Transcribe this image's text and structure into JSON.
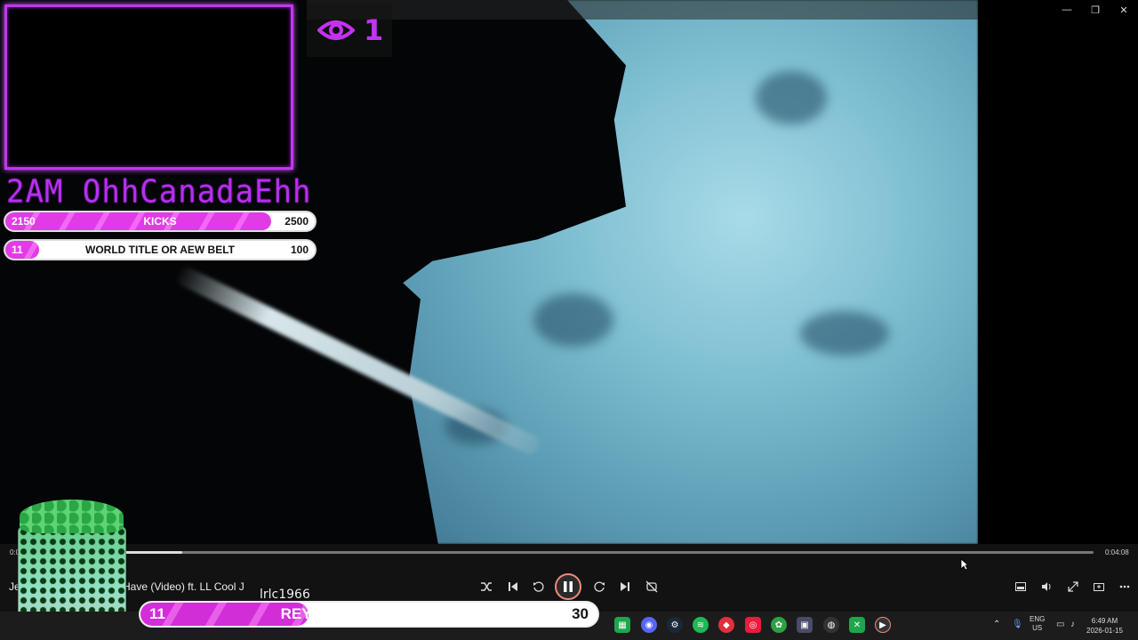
{
  "window": {
    "minimize_icon": "minimize-icon",
    "maximize_icon": "maximize-icon",
    "close_icon": "close-icon",
    "minimize_glyph": "—",
    "maximize_glyph": "❐",
    "close_glyph": "✕"
  },
  "overlay": {
    "viewer_count": "1",
    "streamer_name": "2AM OhhCanadaEhh",
    "goals": [
      {
        "current": "2150",
        "label": "KICKS",
        "target": "2500",
        "progress": 0.86
      },
      {
        "current": "11",
        "label": "WORLD TITLE OR AEW BELT",
        "target": "100",
        "progress": 0.11
      }
    ],
    "big_goal": {
      "current": "11",
      "label": "REY OR KALISTO MASK",
      "target": "30",
      "progress": 0.367
    },
    "user_tag": "lrlc1966"
  },
  "player": {
    "time_elapsed": "0:0",
    "time_total": "0:04:08",
    "progress": 0.15,
    "track_title_start": "Je",
    "track_title_rest": "Have (Video) ft. LL Cool J",
    "controls": {
      "shuffle": "shuffle-icon",
      "previous": "previous-icon",
      "rewind": "rewind-10-icon",
      "pause": "pause-icon",
      "forward": "forward-30-icon",
      "next": "next-icon",
      "repeat": "repeat-off-icon"
    },
    "right_controls": [
      "miniplayer-icon",
      "volume-icon",
      "fullscreen-icon",
      "cast-icon",
      "more-icon"
    ]
  },
  "taskbar": {
    "language": "ENG",
    "region": "US",
    "time": "6:49 AM",
    "date": "2026-01-15",
    "pinned": [
      "spreadsheets-icon",
      "discord-icon",
      "steam-icon",
      "spotify-icon",
      "red-app-icon",
      "red-app-2-icon",
      "green-app-icon",
      "gallery-icon",
      "obs-icon",
      "xbox-icon",
      "media-player-icon"
    ]
  },
  "colors": {
    "accent_purple": "#c236f0",
    "goal_pink": "#e13be6",
    "taskbar": "#1c1c1c"
  }
}
